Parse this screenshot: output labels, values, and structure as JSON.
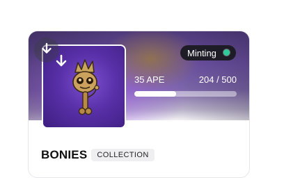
{
  "collection": {
    "name": "BONIES",
    "badge": "COLLECTION",
    "status": "Minting",
    "status_color": "#2ecc9a",
    "price": "35 APE",
    "minted_supply": "204 / 500",
    "minted": 204,
    "total": 500,
    "progress_fraction": 0.408
  },
  "icons": {
    "download_button": "arrow-down-icon",
    "nft_art": "bone-king-figure"
  }
}
